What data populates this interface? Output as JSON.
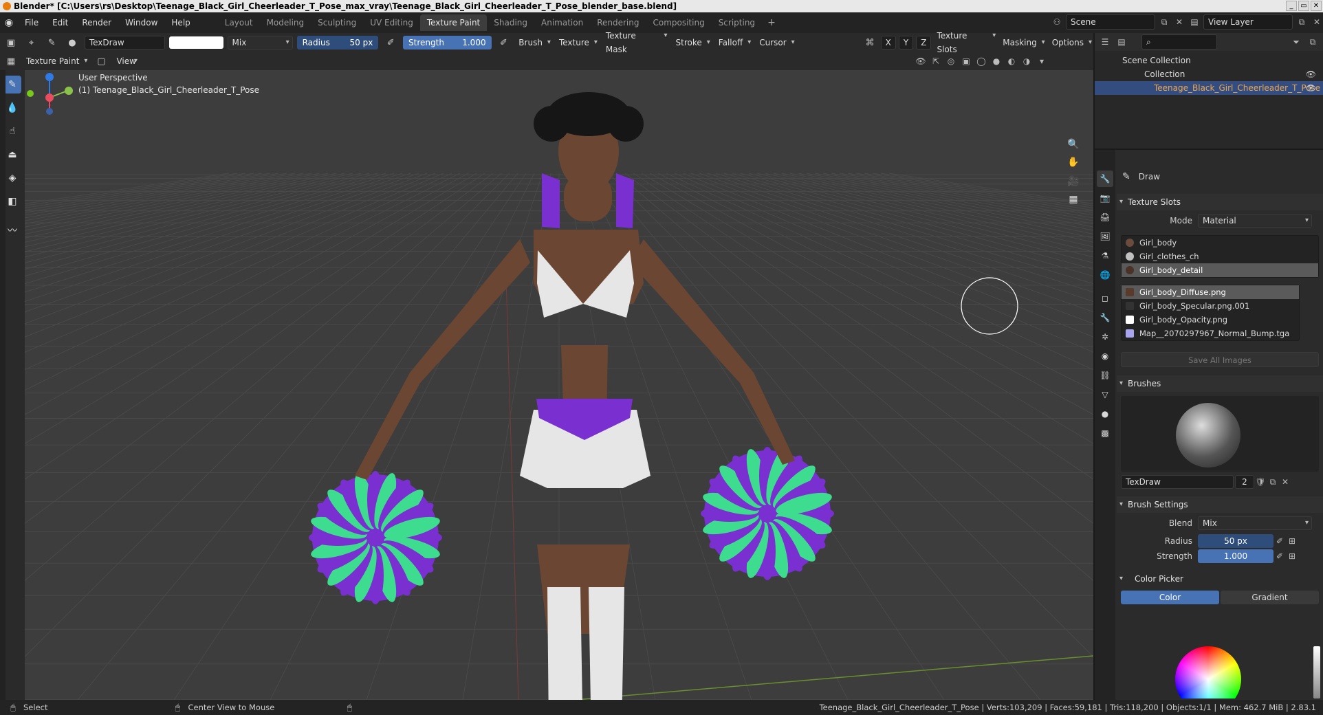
{
  "titlebar": {
    "title": "Blender* [C:\\Users\\rs\\Desktop\\Teenage_Black_Girl_Cheerleader_T_Pose_max_vray\\Teenage_Black_Girl_Cheerleader_T_Pose_blender_base.blend]"
  },
  "menu": {
    "file": "File",
    "edit": "Edit",
    "render": "Render",
    "window": "Window",
    "help": "Help"
  },
  "workspaces": [
    "Layout",
    "Modeling",
    "Sculpting",
    "UV Editing",
    "Texture Paint",
    "Shading",
    "Animation",
    "Rendering",
    "Compositing",
    "Scripting"
  ],
  "active_workspace": "Texture Paint",
  "scene": {
    "scene_name": "Scene",
    "view_layer": "View Layer"
  },
  "toolheader": {
    "brush_name": "TexDraw",
    "blend_mode": "Mix",
    "radius_label": "Radius",
    "radius_value": "50 px",
    "strength_label": "Strength",
    "strength_value": "1.000",
    "menus": [
      "Brush",
      "Texture",
      "Texture Mask",
      "Stroke",
      "Falloff",
      "Cursor"
    ],
    "axes": [
      "X",
      "Y",
      "Z"
    ],
    "right_menus": [
      "Texture Slots",
      "Masking",
      "Options"
    ]
  },
  "modeheader": {
    "mode": "Texture Paint",
    "view": "View"
  },
  "viewport": {
    "perspective_label": "User Perspective",
    "object_label": "(1) Teenage_Black_Girl_Cheerleader_T_Pose",
    "colors": {
      "bg": "#3d3d3d",
      "grid": "#494949",
      "skin": "#6b4632",
      "outfit": "#e6e6e6",
      "purple": "#7a2fd0",
      "green": "#3ddc8f"
    }
  },
  "outliner": {
    "root": "Scene Collection",
    "collection": "Collection",
    "object": "Teenage_Black_Girl_Cheerleader_T_Pose"
  },
  "properties": {
    "tool_name": "Draw",
    "texture_slots": {
      "title": "Texture Slots",
      "mode_label": "Mode",
      "mode_value": "Material",
      "materials": [
        "Girl_body",
        "Girl_clothes_ch",
        "Girl_body_detail"
      ],
      "images": [
        "Girl_body_Diffuse.png",
        "Girl_body_Specular.png.001",
        "Girl_body_Opacity.png",
        "Map__2070297967_Normal_Bump.tga"
      ],
      "save_all": "Save All Images"
    },
    "brushes": {
      "title": "Brushes",
      "name": "TexDraw",
      "users": "2"
    },
    "brush_settings": {
      "title": "Brush Settings",
      "blend_label": "Blend",
      "blend_value": "Mix",
      "radius_label": "Radius",
      "radius_value": "50 px",
      "strength_label": "Strength",
      "strength_value": "1.000"
    },
    "color_picker": {
      "title": "Color Picker",
      "color_tab": "Color",
      "gradient_tab": "Gradient"
    }
  },
  "statusbar": {
    "select": "Select",
    "center": "Center View to Mouse",
    "stats": "Teenage_Black_Girl_Cheerleader_T_Pose | Verts:103,209 | Faces:59,181 | Tris:118,200 | Objects:1/1 | Mem: 462.7 MiB | 2.83.1"
  }
}
